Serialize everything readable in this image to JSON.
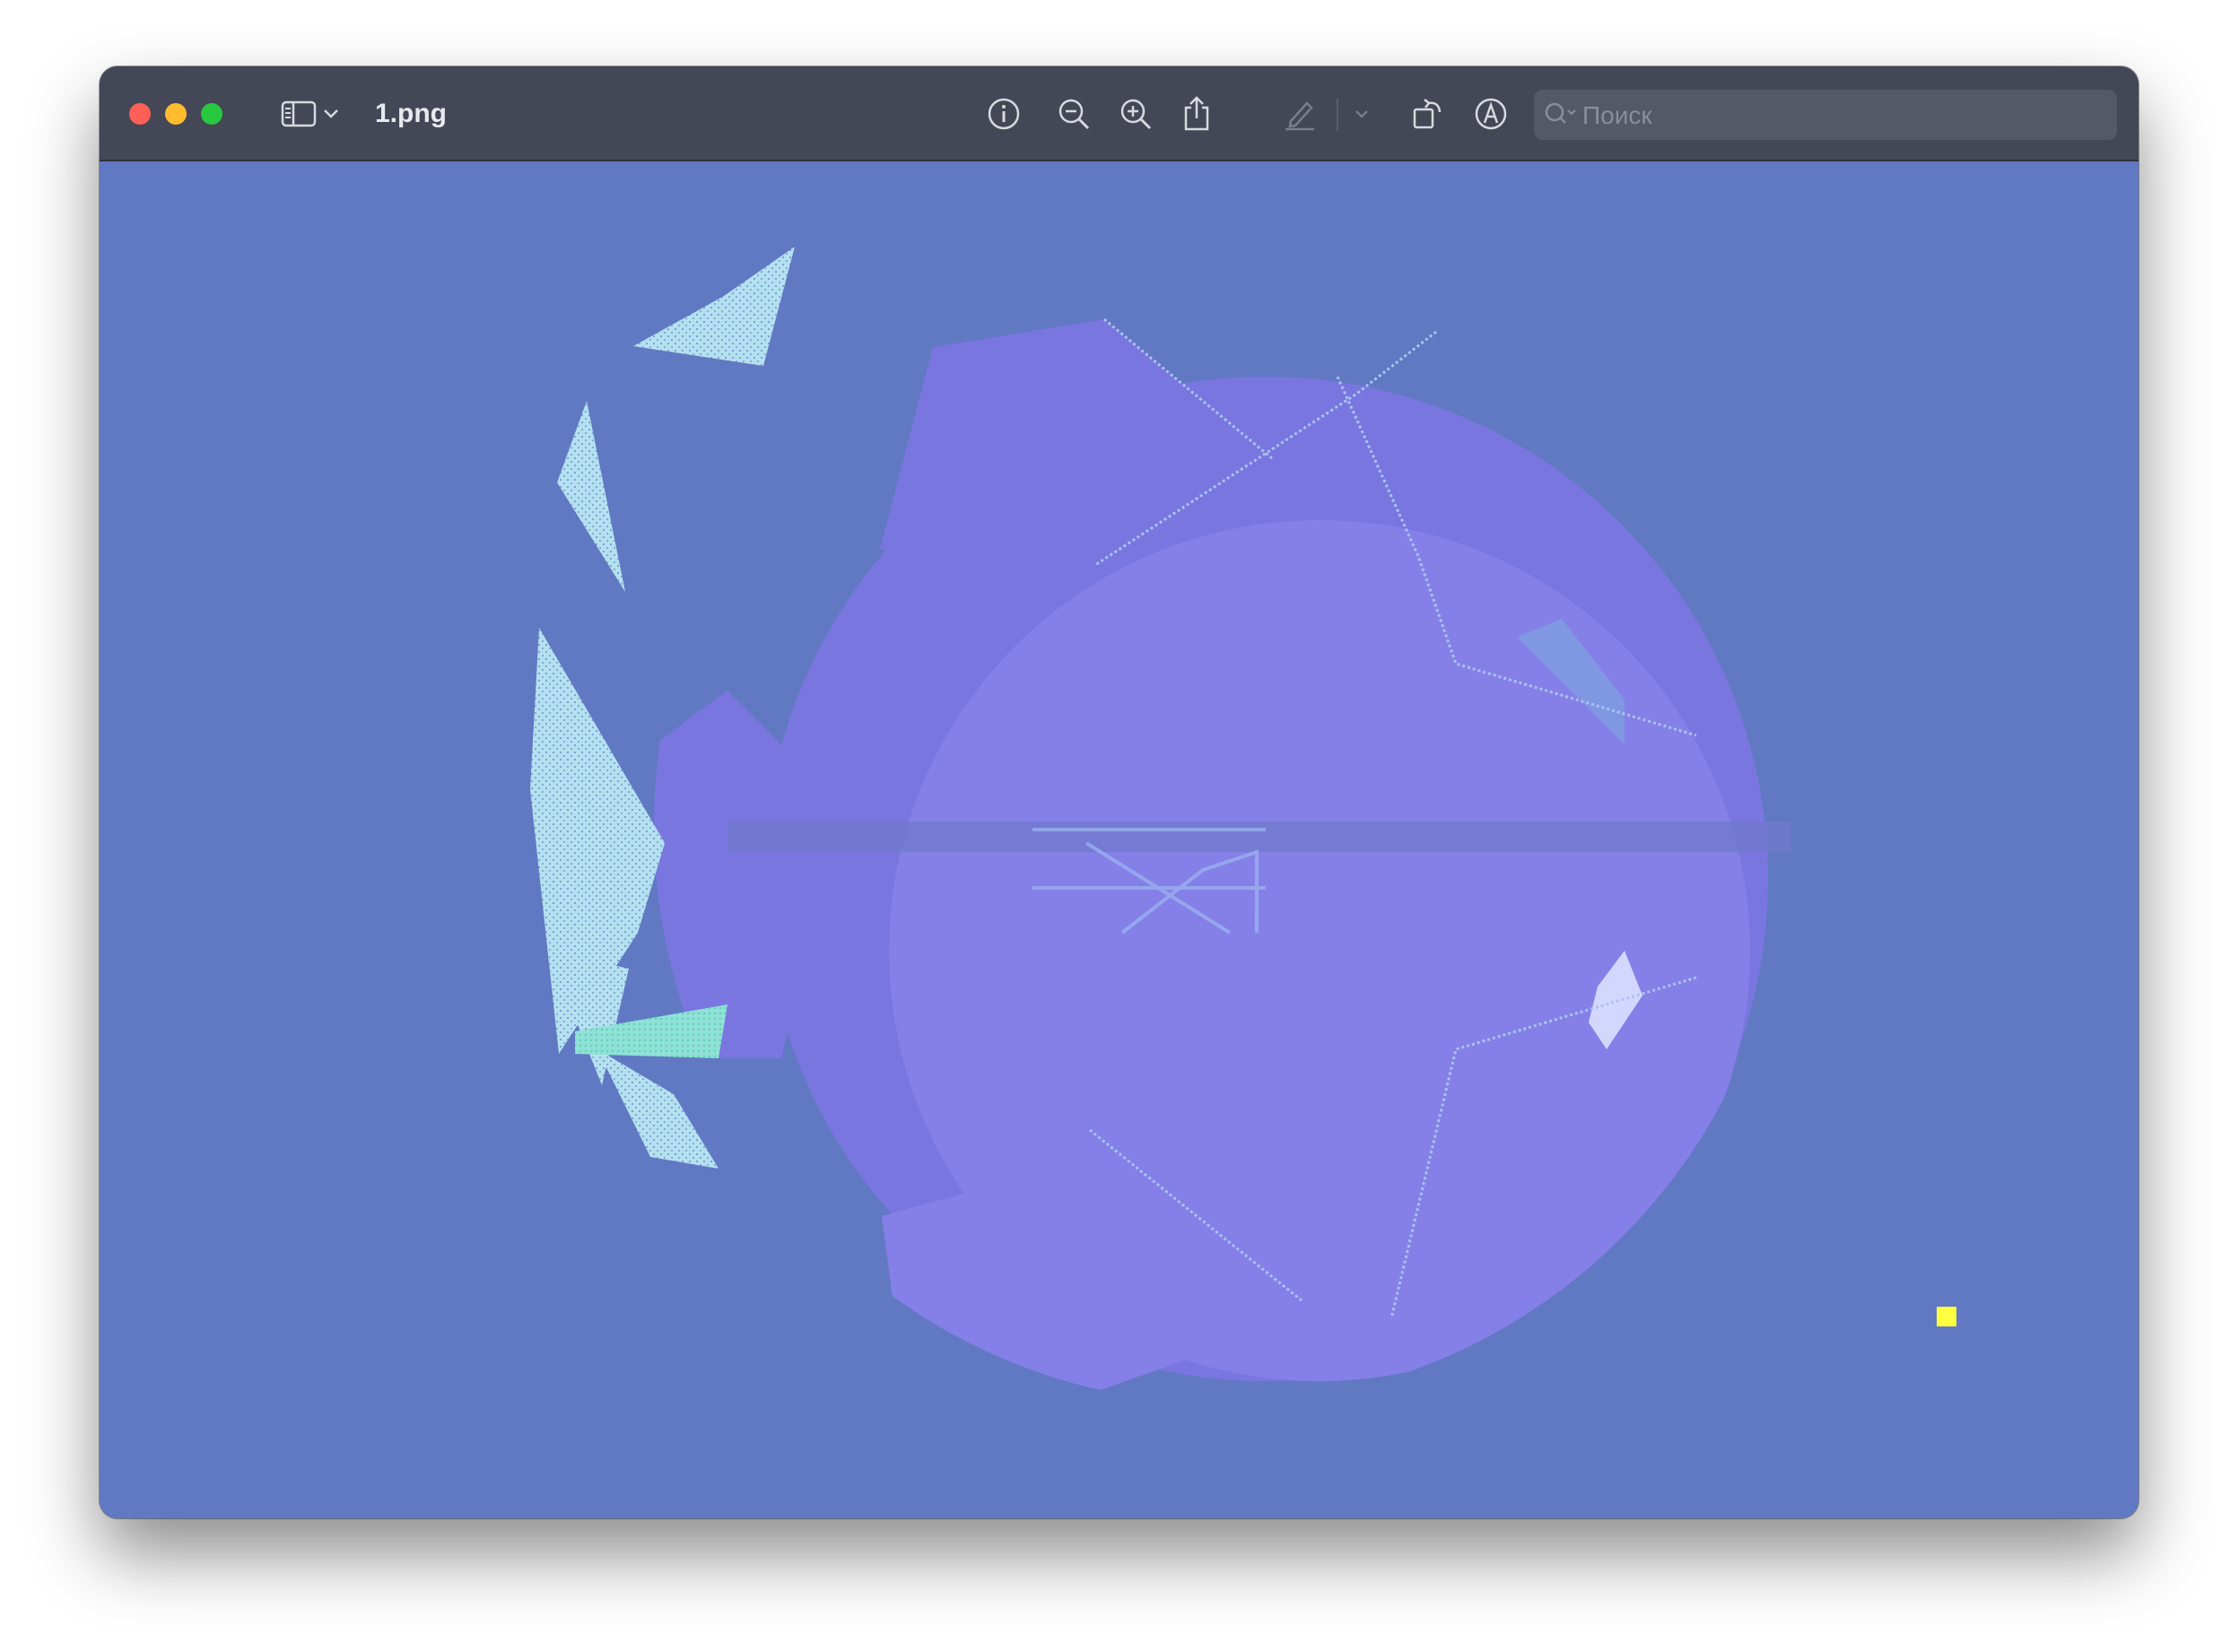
{
  "window": {
    "title": "1.png",
    "traffic_colors": {
      "close": "#fe5f57",
      "minimize": "#febc2e",
      "zoom": "#28c840"
    }
  },
  "toolbar": {
    "icons": [
      "sidebar-toggle-icon",
      "chevron-down-icon",
      "info-icon",
      "zoom-out-icon",
      "zoom-in-icon",
      "share-icon",
      "highlight-pen-icon",
      "chevron-down-icon",
      "rotate-icon",
      "markup-icon"
    ]
  },
  "search": {
    "placeholder": "Поиск",
    "value": ""
  },
  "image": {
    "background_color": "#6178c2",
    "accent_color": "#8580e8",
    "light_color": "#b3e1ef",
    "marker_color": "#ffff40"
  }
}
